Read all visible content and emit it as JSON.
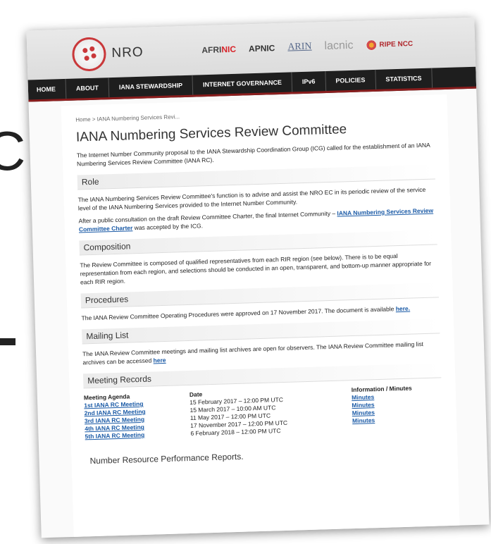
{
  "background": {
    "letter_c": "C"
  },
  "banner": {
    "nro_text": "NRO",
    "rirs": {
      "afrinic_a": "AFRI",
      "afrinic_b": "NIC",
      "apnic": "APNIC",
      "arin": "ARIN",
      "lacnic": "lacnic",
      "ripe": "RIPE NCC"
    }
  },
  "nav": [
    "HOME",
    "ABOUT",
    "IANA STEWARDSHIP",
    "INTERNET GOVERNANCE",
    "IPv6",
    "POLICIES",
    "STATISTICS"
  ],
  "breadcrumb": "Home > IANA Numbering Services Revi...",
  "title": "IANA Numbering Services Review Committee",
  "intro": "The Internet Number Community proposal to the IANA Stewardship Coordination Group (ICG) called for the establishment of an IANA Numbering Services Review Committee (IANA RC).",
  "role": {
    "heading": "Role",
    "p1": "The IANA Numbering Services Review Committee's function is to advise and assist the NRO EC in its periodic review of the service level of the IANA Numbering Services provided to the Internet Number Community.",
    "p2_pre": "After a public consultation on the draft Review Committee Charter, the final Internet Community – ",
    "p2_link": "IANA Numbering Services Review Committee Charter",
    "p2_post": " was accepted by the ICG."
  },
  "composition": {
    "heading": "Composition",
    "p": "The Review Committee is composed of qualified representatives from each RIR region (see below). There is to be equal representation from each region, and selections should be conducted in an open, transparent, and bottom-up manner appropriate for each RIR region."
  },
  "procedures": {
    "heading": "Procedures",
    "pre": "The IANA Review Committee Operating Procedures were approved on 17 November 2017. The document is available ",
    "link": "here."
  },
  "mailing": {
    "heading": "Mailing List",
    "pre": "The IANA Review Committee meetings and mailing list archives are open for observers. The IANA Review Committee mailing list archives can be accessed ",
    "link": "here"
  },
  "records": {
    "heading": "Meeting Records",
    "col_agenda": "Meeting Agenda",
    "col_date": "Date",
    "col_info": "Information / Minutes",
    "agendas": [
      "1st IANA RC Meeting",
      "2nd IANA RC Meeting",
      "3rd IANA RC Meeting",
      "4th IANA RC Meeting",
      "5th IANA RC Meeting"
    ],
    "dates": [
      "15 February 2017 – 12:00 PM UTC",
      "15 March 2017 – 10:00 AM UTC",
      "11 May 2017 – 12:00 PM UTC",
      "17 November 2017 – 12:00 PM UTC",
      "6 February 2018 – 12:00 PM UTC"
    ],
    "minutes": [
      "Minutes",
      "Minutes",
      "Minutes",
      "Minutes"
    ]
  },
  "footer_heading": "Number Resource Performance Reports."
}
